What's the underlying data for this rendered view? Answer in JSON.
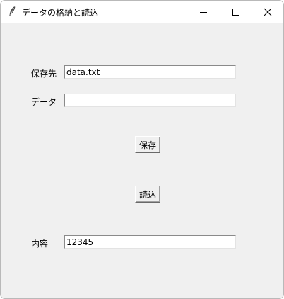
{
  "window": {
    "title": "データの格納と読込",
    "icon": "feather-icon",
    "controls": {
      "minimize": "minimize-icon",
      "maximize": "maximize-icon",
      "close": "close-icon"
    }
  },
  "form": {
    "save_dest_label": "保存先",
    "save_dest_value": "data.txt",
    "data_label": "データ",
    "data_value": "",
    "save_button": "保存",
    "load_button": "読込",
    "content_label": "内容",
    "content_value": "12345"
  }
}
